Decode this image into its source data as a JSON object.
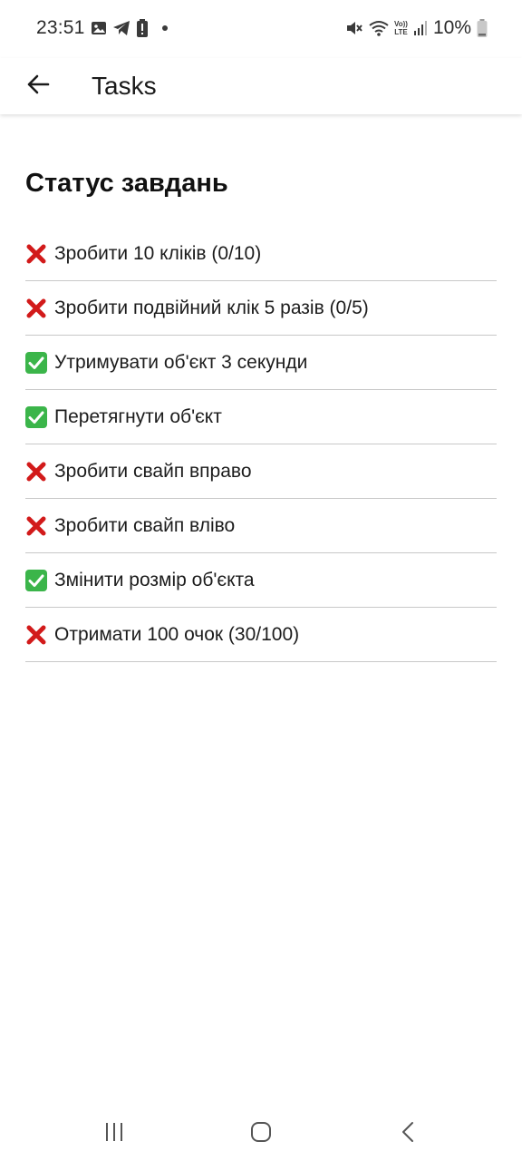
{
  "status_bar": {
    "time": "23:51",
    "battery_text": "10%",
    "left_icons": [
      "gallery-icon",
      "telegram-icon",
      "battery-alert-icon",
      "dot-icon"
    ],
    "right_icons": [
      "mute-icon",
      "wifi-icon",
      "volte-icon",
      "signal-icon",
      "battery-icon"
    ],
    "volte_label_top": "Vo))",
    "volte_label_bottom": "LTE"
  },
  "app_bar": {
    "title": "Tasks",
    "back_icon": "arrow-left-icon"
  },
  "section": {
    "title": "Статус завдань"
  },
  "tasks": [
    {
      "status": "incomplete",
      "icon": "red-cross-icon",
      "label": "Зробити 10 кліків (0/10)"
    },
    {
      "status": "incomplete",
      "icon": "red-cross-icon",
      "label": "Зробити подвійний клік 5 разів (0/5)"
    },
    {
      "status": "complete",
      "icon": "green-check-icon",
      "label": "Утримувати об'єкт 3 секунди"
    },
    {
      "status": "complete",
      "icon": "green-check-icon",
      "label": "Перетягнути об'єкт"
    },
    {
      "status": "incomplete",
      "icon": "red-cross-icon",
      "label": "Зробити свайп вправо"
    },
    {
      "status": "incomplete",
      "icon": "red-cross-icon",
      "label": "Зробити свайп вліво"
    },
    {
      "status": "complete",
      "icon": "green-check-icon",
      "label": "Змінити розмір об'єкта"
    },
    {
      "status": "incomplete",
      "icon": "red-cross-icon",
      "label": "Отримати 100 очок (30/100)"
    }
  ],
  "nav_bar": {
    "buttons": [
      "recent-apps-icon",
      "home-icon",
      "back-nav-icon"
    ]
  },
  "colors": {
    "cross_red": "#d21a1a",
    "check_green": "#3bb54a",
    "divider": "#c8c8c8",
    "text": "#1c1c1c"
  }
}
